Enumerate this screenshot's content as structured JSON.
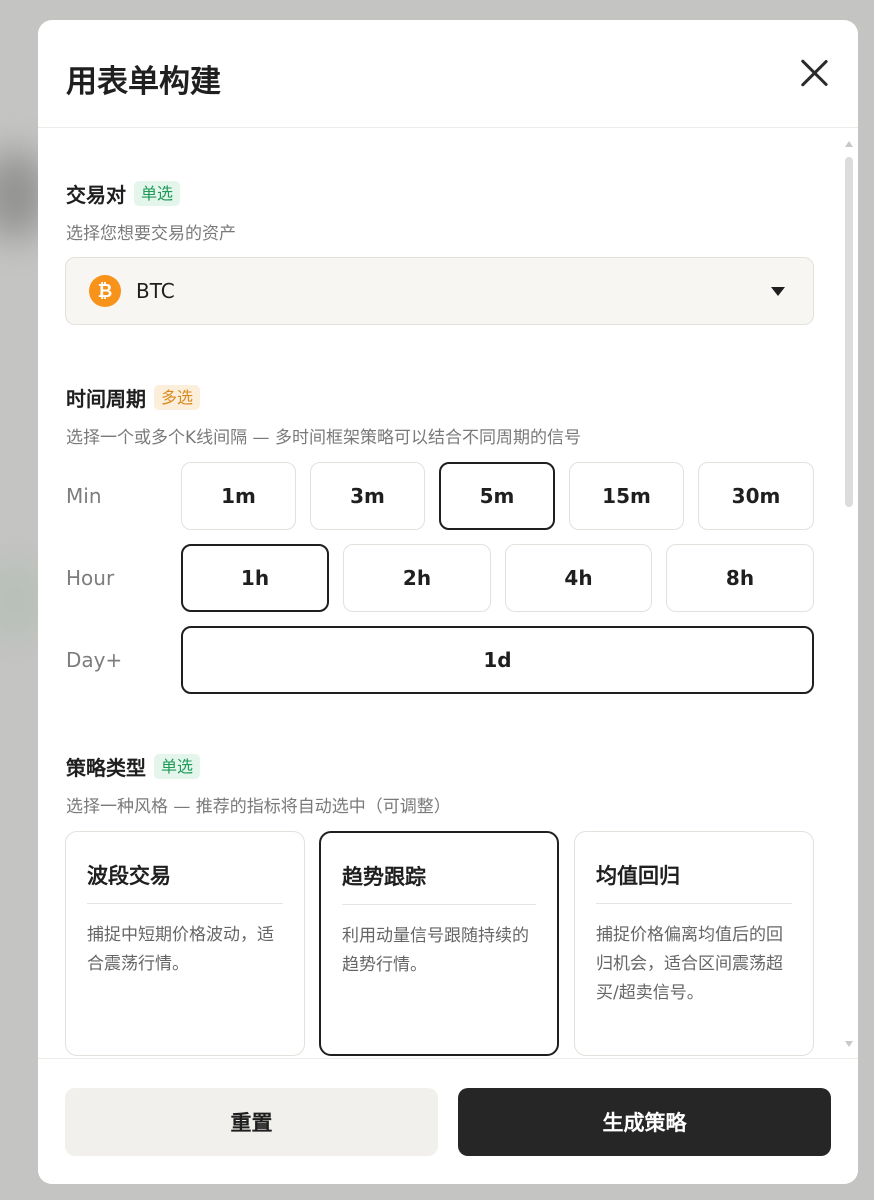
{
  "modal": {
    "title": "用表单构建"
  },
  "pair_section": {
    "title": "交易对",
    "tag": "单选",
    "description": "选择您想要交易的资产",
    "selected_asset": "BTC",
    "asset_icon": "bitcoin-icon",
    "asset_icon_glyph": "₿"
  },
  "timeframe_section": {
    "title": "时间周期",
    "tag": "多选",
    "description": "选择一个或多个K线间隔 — 多时间框架策略可以结合不同周期的信号",
    "rows": [
      {
        "label": "Min",
        "options": [
          {
            "label": "1m",
            "selected": false
          },
          {
            "label": "3m",
            "selected": false
          },
          {
            "label": "5m",
            "selected": true
          },
          {
            "label": "15m",
            "selected": false
          },
          {
            "label": "30m",
            "selected": false
          }
        ]
      },
      {
        "label": "Hour",
        "options": [
          {
            "label": "1h",
            "selected": true
          },
          {
            "label": "2h",
            "selected": false
          },
          {
            "label": "4h",
            "selected": false
          },
          {
            "label": "8h",
            "selected": false
          }
        ]
      },
      {
        "label": "Day+",
        "options": [
          {
            "label": "1d",
            "selected": true
          }
        ]
      }
    ]
  },
  "strategy_section": {
    "title": "策略类型",
    "tag": "单选",
    "description": "选择一种风格 — 推荐的指标将自动选中（可调整）",
    "cards": [
      {
        "title": "波段交易",
        "description": "捕捉中短期价格波动，适合震荡行情。",
        "selected": false
      },
      {
        "title": "趋势跟踪",
        "description": "利用动量信号跟随持续的趋势行情。",
        "selected": true
      },
      {
        "title": "均值回归",
        "description": "捕捉价格偏离均值后的回归机会，适合区间震荡超买/超卖信号。",
        "selected": false
      }
    ]
  },
  "footer": {
    "reset_label": "重置",
    "generate_label": "生成策略"
  },
  "colors": {
    "accent_dark": "#262626",
    "tag_green": "#1f9a58",
    "tag_orange": "#d98a1c",
    "bitcoin": "#f7931a"
  }
}
